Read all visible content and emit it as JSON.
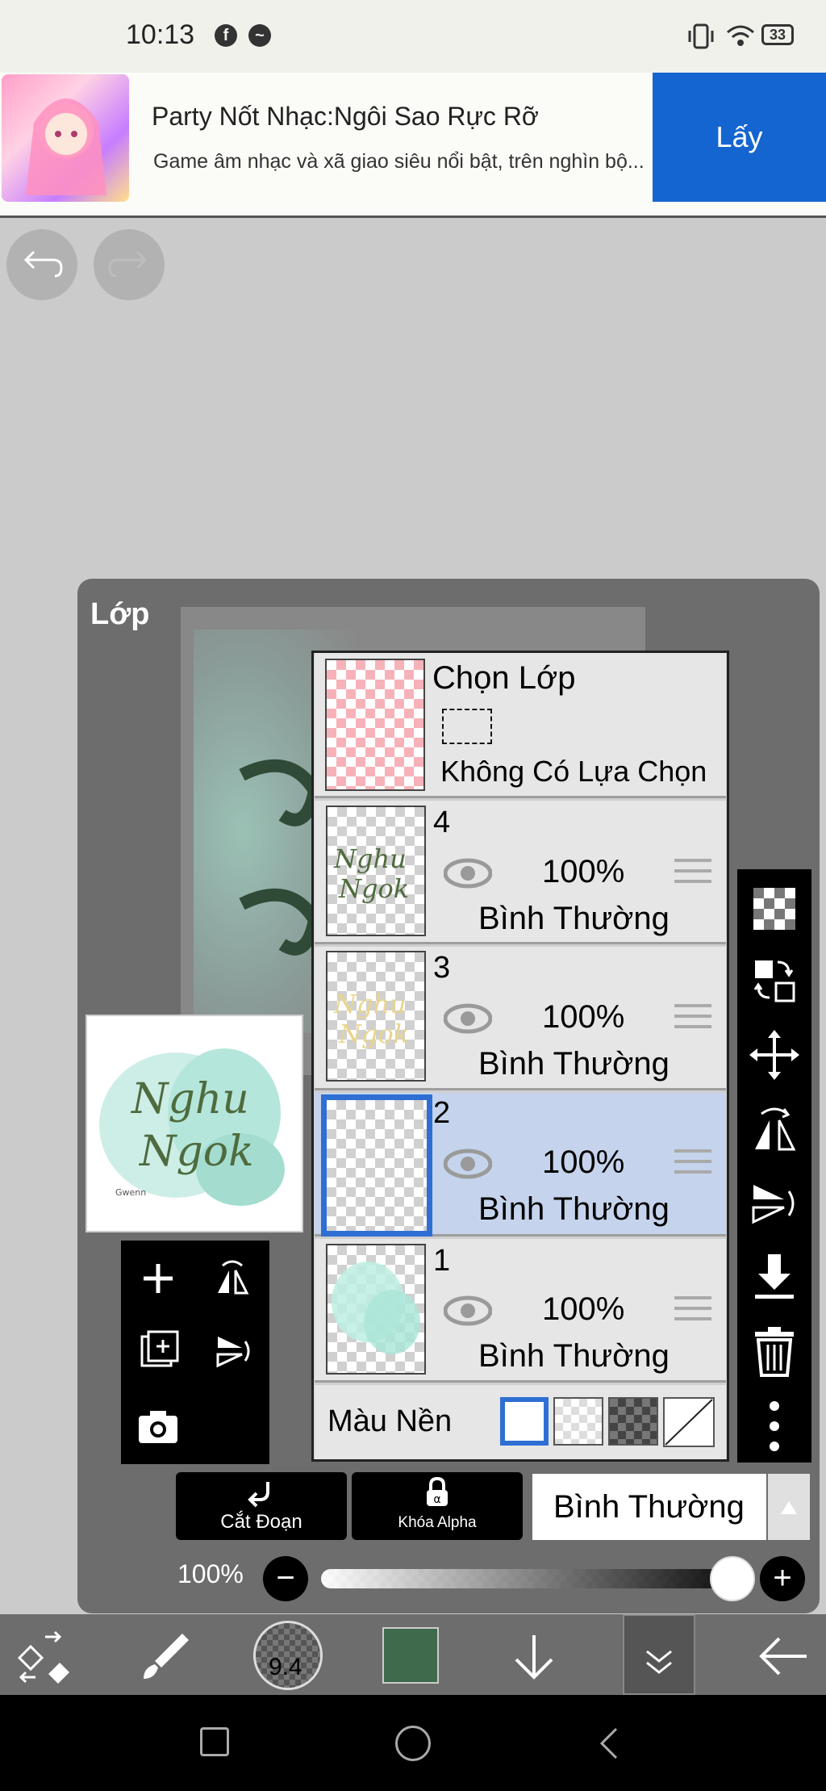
{
  "status_bar": {
    "time": "10:13",
    "battery": "33"
  },
  "ad": {
    "title": "Party Nốt Nhạc:Ngôi Sao Rực Rỡ",
    "subtitle": "Game âm nhạc và xã giao siêu nổi bật, trên nghìn bộ...",
    "button": "Lấy"
  },
  "panel": {
    "title": "Lớp"
  },
  "selection_layer": {
    "title": "Chọn Lớp",
    "status": "Không Có Lựa Chọn"
  },
  "layers": [
    {
      "number": "4",
      "opacity": "100%",
      "mode": "Bình Thường",
      "selected": false
    },
    {
      "number": "3",
      "opacity": "100%",
      "mode": "Bình Thường",
      "selected": false
    },
    {
      "number": "2",
      "opacity": "100%",
      "mode": "Bình Thường",
      "selected": true
    },
    {
      "number": "1",
      "opacity": "100%",
      "mode": "Bình Thường",
      "selected": false
    }
  ],
  "background": {
    "label": "Màu Nền"
  },
  "buttons": {
    "clipping": "Cắt Đoạn",
    "alpha_lock": "Khóa Alpha"
  },
  "blend_mode": {
    "value": "Bình Thường"
  },
  "opacity": {
    "label": "100%",
    "value": 1.0
  },
  "toolbar": {
    "brush_size": "9.4",
    "color": "#3f6a4b"
  },
  "artwork_text": {
    "line1": "Nghu",
    "line2": "Ngok",
    "signature": "Gwenn"
  }
}
